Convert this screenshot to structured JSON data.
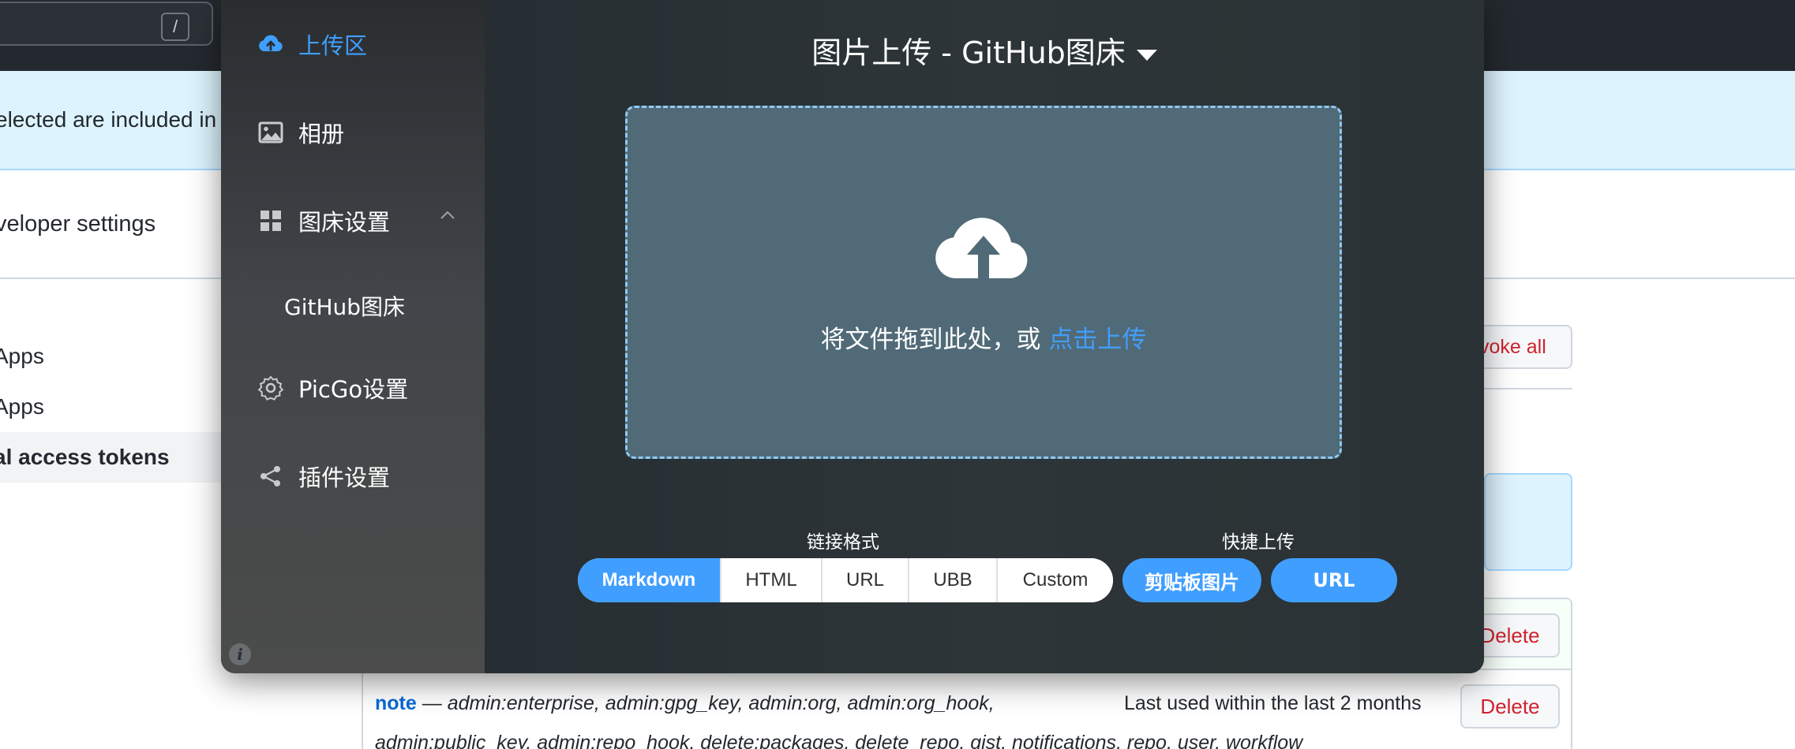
{
  "background_page": {
    "search_shortcut": "/",
    "flash_text": "elected are included in",
    "breadcrumb": "veloper settings",
    "nav_items": [
      "Apps",
      "Apps",
      "al access tokens"
    ],
    "revoke_all_label": "voke all",
    "delete_label": "Delete",
    "token": {
      "name": "note",
      "separator": " — ",
      "scopes_line1": "admin:enterprise, admin:gpg_key, admin:org, admin:org_hook,",
      "scopes_line2": "admin:public_key, admin:repo_hook, delete:packages, delete_repo, gist, notifications, repo, user, workflow",
      "last_used": "Last used within the last 2 months"
    }
  },
  "picgo": {
    "sidebar": {
      "items": [
        {
          "label": "上传区",
          "icon": "cloud-upload-icon",
          "active": true
        },
        {
          "label": "相册",
          "icon": "image-icon"
        },
        {
          "label": "图床设置",
          "icon": "grid-icon"
        },
        {
          "label": "PicGo设置",
          "icon": "gear-icon"
        },
        {
          "label": "插件设置",
          "icon": "share-icon"
        }
      ],
      "sub_item": "GitHub图床",
      "info_glyph": "i"
    },
    "title": "图片上传 - GitHub图床",
    "dropzone": {
      "text": "将文件拖到此处，或 ",
      "link": "点击上传"
    },
    "link_format": {
      "label": "链接格式",
      "options": [
        "Markdown",
        "HTML",
        "URL",
        "UBB",
        "Custom"
      ],
      "selected": "Markdown"
    },
    "quick_upload": {
      "label": "快捷上传",
      "buttons": [
        "剪贴板图片",
        "URL"
      ]
    },
    "colors": {
      "accent": "#409eff",
      "dropzone_bg": "#516a77",
      "dropzone_border": "#8fc9f5"
    }
  }
}
